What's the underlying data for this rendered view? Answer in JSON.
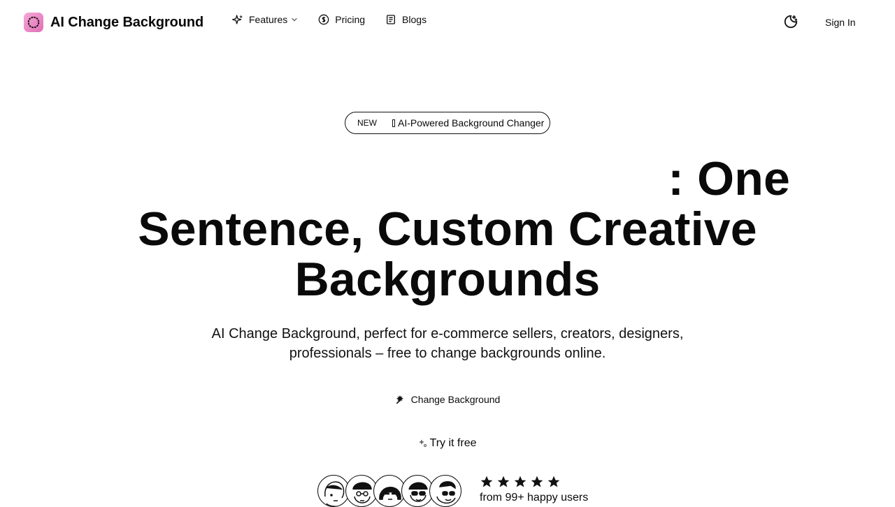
{
  "brand": {
    "name": "AI Change Background",
    "logo_icon": "circle-logo-icon",
    "accent": "#e06fb6"
  },
  "nav": [
    {
      "label": "Features",
      "icon": "sparkles-icon",
      "has_dropdown": true
    },
    {
      "label": "Pricing",
      "icon": "dollar-circle-icon"
    },
    {
      "label": "Blogs",
      "icon": "document-icon"
    }
  ],
  "header": {
    "theme_icon": "moon-stars-icon",
    "signin_label": "Sign In"
  },
  "badge": {
    "tag": "NEW",
    "text": "AI-Powered Background Changer"
  },
  "hero": {
    "title_line1": ": One",
    "title_line2": "Sentence, Custom Creative",
    "title_line3": "Backgrounds",
    "subtitle": "AI Change Background, perfect for e-commerce sellers, creators, designers, professionals – free to change backgrounds online.",
    "primary_cta": "Change Background",
    "primary_cta_icon": "magic-wand-icon",
    "secondary_cta": "Try it free",
    "secondary_cta_icon": "sparkle-icon"
  },
  "social_proof": {
    "avatar_count": 5,
    "rating": 5,
    "users_text": "from 99+ happy users"
  }
}
